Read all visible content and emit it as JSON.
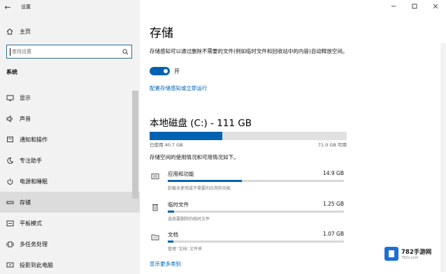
{
  "window": {
    "app_title": "设置",
    "minimize": "—",
    "maximize": "☐",
    "close": "✕"
  },
  "sidebar": {
    "home_label": "主页",
    "search_placeholder": "查找设置",
    "section_title": "系统",
    "items": [
      {
        "label": "显示",
        "icon": "display-icon"
      },
      {
        "label": "声音",
        "icon": "speaker-icon"
      },
      {
        "label": "通知和操作",
        "icon": "notification-icon"
      },
      {
        "label": "专注助手",
        "icon": "moon-icon"
      },
      {
        "label": "电源和睡眠",
        "icon": "power-icon"
      },
      {
        "label": "存储",
        "icon": "storage-icon",
        "active": true
      },
      {
        "label": "平板模式",
        "icon": "tablet-icon"
      },
      {
        "label": "多任务处理",
        "icon": "multitask-icon"
      },
      {
        "label": "投影到此电脑",
        "icon": "project-icon"
      }
    ]
  },
  "main": {
    "title": "存储",
    "description": "存储感知可以通过删除不需要的文件(例如临时文件和回收站中的内容)自动释放空间。",
    "toggle_state": "开",
    "toggle_on": true,
    "config_link": "配置存储感知或立即运行",
    "drive": {
      "title": "本地磁盘 (C:) - 111 GB",
      "used_label": "已使用 40.7 GB",
      "free_label": "71.0 GB 可用",
      "used_fraction": 0.37
    },
    "usage_intro": "存储空间的使用情况和可用情况如下。",
    "categories": [
      {
        "name": "应用和功能",
        "size": "14.9 GB",
        "desc": "卸载未使用或不需要的应用和功能",
        "fraction": 0.42,
        "icon": "apps-icon"
      },
      {
        "name": "临时文件",
        "size": "1.25 GB",
        "desc": "选择要删除的临时文件",
        "fraction": 0.035,
        "icon": "trash-icon"
      },
      {
        "name": "文档",
        "size": "1.07 GB",
        "desc": "管理 '文档' 文件夹",
        "fraction": 0.03,
        "icon": "documents-icon"
      }
    ],
    "more_link": "显示更多类别"
  },
  "watermark": {
    "name": "782手游网",
    "url": "782s.com"
  },
  "colors": {
    "accent": "#0063b1",
    "sidebar_bg": "#f2f2f2",
    "active_item": "#dcdcdc"
  }
}
